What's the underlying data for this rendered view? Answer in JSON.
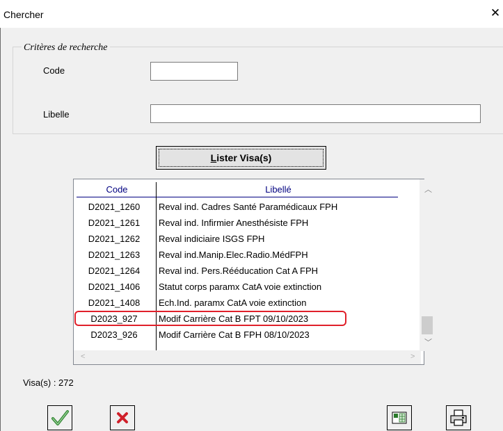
{
  "window": {
    "title": "Chercher",
    "close_glyph": "✕"
  },
  "criteria": {
    "legend": "Critères de recherche",
    "code_label": "Code",
    "code_value": "",
    "libelle_label": "Libelle",
    "libelle_value": ""
  },
  "list_button": {
    "label_first": "L",
    "label_rest": "ister Visa(s)"
  },
  "table": {
    "columns": [
      "Code",
      "Libellé"
    ],
    "rows": [
      {
        "code": "D2021_1260",
        "libelle": "Reval ind. Cadres Santé Paramédicaux FPH"
      },
      {
        "code": "D2021_1261",
        "libelle": "Reval ind. Infirmier Anesthésiste FPH"
      },
      {
        "code": "D2021_1262",
        "libelle": "Reval indiciaire ISGS FPH"
      },
      {
        "code": "D2021_1263",
        "libelle": "Reval ind.Manip.Elec.Radio.MédFPH"
      },
      {
        "code": "D2021_1264",
        "libelle": "Reval ind. Pers.Rééducation Cat A FPH"
      },
      {
        "code": "D2021_1406",
        "libelle": "Statut corps paramx CatA voie extinction"
      },
      {
        "code": "D2021_1408",
        "libelle": "Ech.Ind. paramx CatA voie extinction"
      },
      {
        "code": "D2023_927",
        "libelle": "Modif Carrière Cat B FPT 09/10/2023"
      },
      {
        "code": "D2023_926",
        "libelle": "Modif Carrière Cat B FPH 08/10/2023"
      }
    ],
    "highlighted_row": 7
  },
  "count": {
    "text": "Visa(s) : 272"
  },
  "toolbar": {
    "buttons": [
      "validate-icon",
      "cancel-icon",
      "calculator-icon",
      "print-icon"
    ]
  },
  "colors": {
    "header_text": "#000080",
    "highlight": "#e0202a",
    "check_green": "#3a8a3a",
    "cross_red": "#d0202a"
  }
}
